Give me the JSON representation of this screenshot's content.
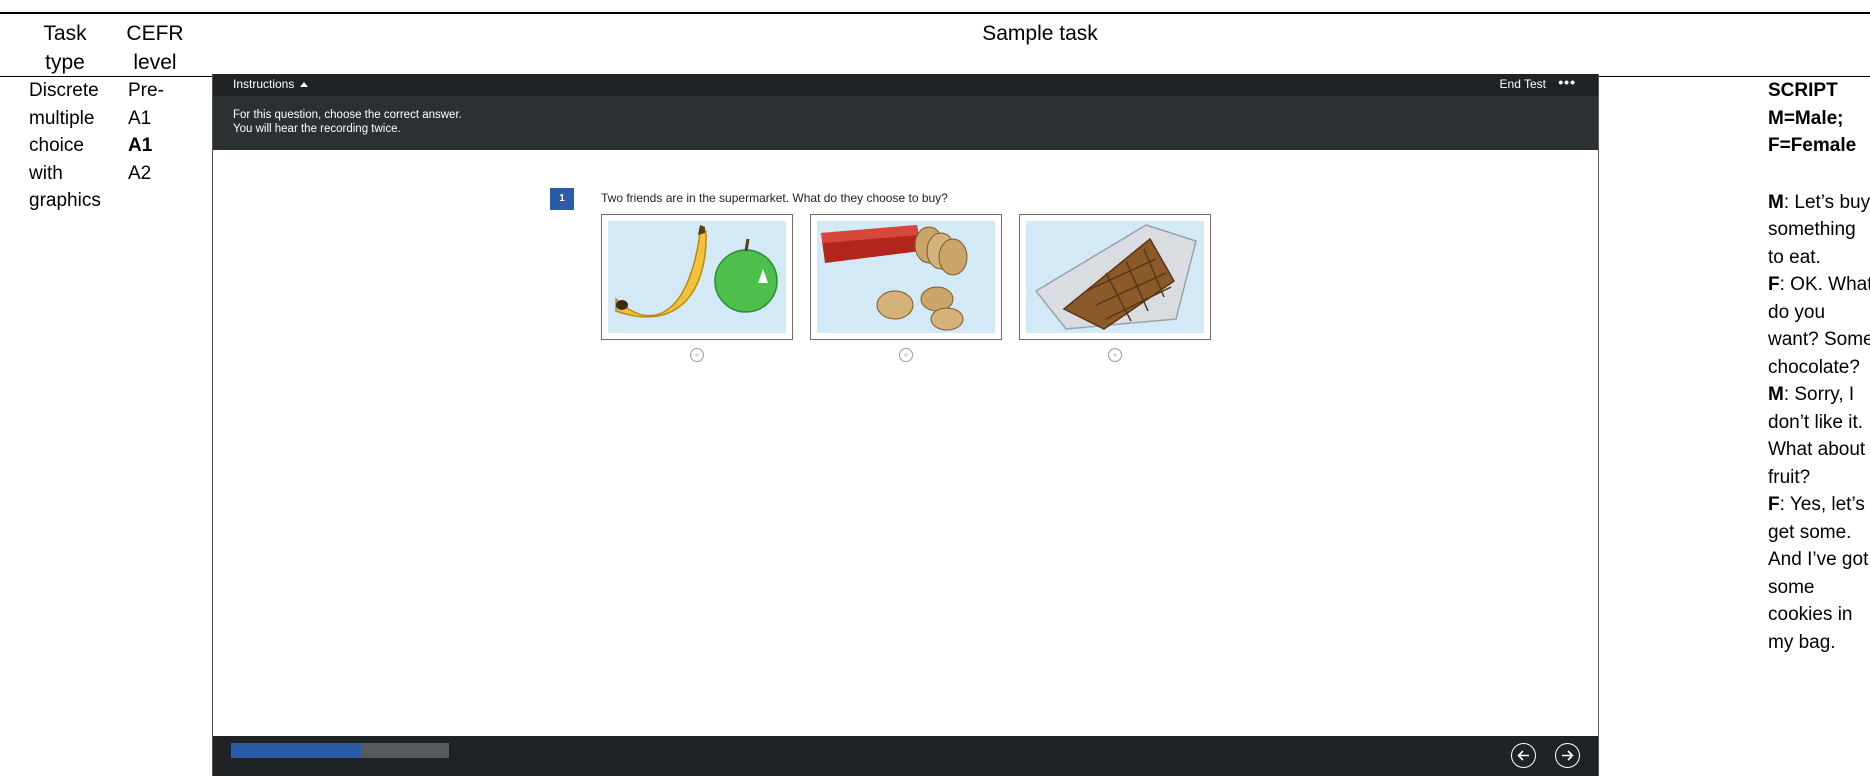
{
  "headers": {
    "task_type": [
      "Task",
      "type"
    ],
    "cefr_level": [
      "CEFR",
      "level"
    ],
    "sample_task": "Sample task"
  },
  "task_type": [
    "Discrete",
    "multiple",
    "choice",
    "with",
    "graphics"
  ],
  "cefr_levels": [
    "Pre-",
    "A1",
    "A1",
    "A2"
  ],
  "app": {
    "instructions_label": "Instructions",
    "end_test_label": "End Test",
    "more_label": "•••",
    "instructions_lines": [
      "For this question, choose the correct answer.",
      "You will hear the recording twice."
    ],
    "question_number": "1",
    "question_text": "Two friends are in the supermarket. What do they choose to buy?",
    "options": [
      {
        "picture": "banana-and-apple"
      },
      {
        "picture": "cookies"
      },
      {
        "picture": "chocolate-bar"
      }
    ],
    "progress_fraction": 0.6,
    "colors": {
      "accent": "#2a5da5",
      "bar": "#1f2326",
      "panel": "#2b3033"
    }
  },
  "script": {
    "title": [
      "SCRIPT",
      "M=Male;",
      "F=Female"
    ],
    "lines": [
      {
        "speaker": "M",
        "text": ": Let’s buy"
      },
      {
        "speaker": "",
        "text": "something"
      },
      {
        "speaker": "",
        "text": "to eat."
      },
      {
        "speaker": "F",
        "text": ": OK. What"
      },
      {
        "speaker": "",
        "text": "do you"
      },
      {
        "speaker": "",
        "text": "want? Some"
      },
      {
        "speaker": "",
        "text": "chocolate?"
      },
      {
        "speaker": "M",
        "text": ": Sorry, I"
      },
      {
        "speaker": "",
        "text": "don’t like it."
      },
      {
        "speaker": "",
        "text": "What about"
      },
      {
        "speaker": "",
        "text": "fruit?"
      },
      {
        "speaker": "F",
        "text": ": Yes, let’s"
      },
      {
        "speaker": "",
        "text": "get some."
      },
      {
        "speaker": "",
        "text": "And I’ve got"
      },
      {
        "speaker": "",
        "text": "some"
      },
      {
        "speaker": "",
        "text": "cookies in"
      },
      {
        "speaker": "",
        "text": "my bag."
      }
    ]
  }
}
